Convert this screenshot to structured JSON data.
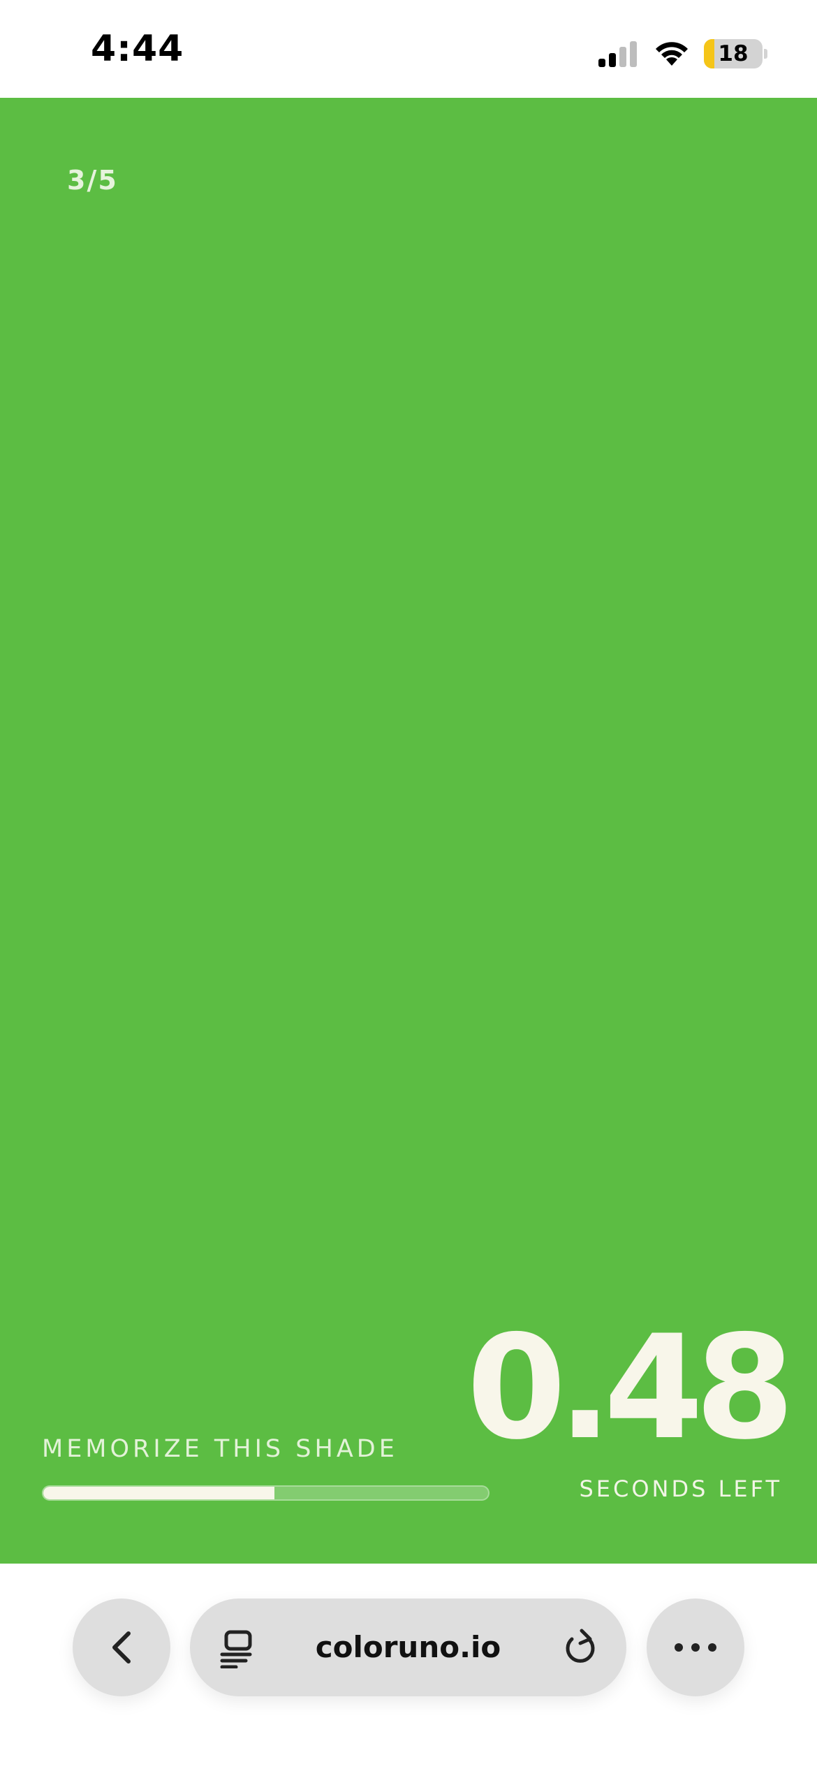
{
  "status_bar": {
    "time": "4:44",
    "battery_level": "18",
    "battery_fraction": 0.18,
    "battery_color": "#f5c518"
  },
  "game": {
    "background_color": "#5cbd43",
    "round_counter": "3/5",
    "timer_value": "0.48",
    "timer_label": "SECONDS LEFT",
    "instruction": "MEMORIZE THIS SHADE",
    "progress_fraction": 0.52
  },
  "browser": {
    "url": "coloruno.io",
    "back_icon": "chevron-left-icon",
    "tabs_icon": "tabs-icon",
    "reload_icon": "reload-icon",
    "more_icon": "ellipsis-icon"
  }
}
